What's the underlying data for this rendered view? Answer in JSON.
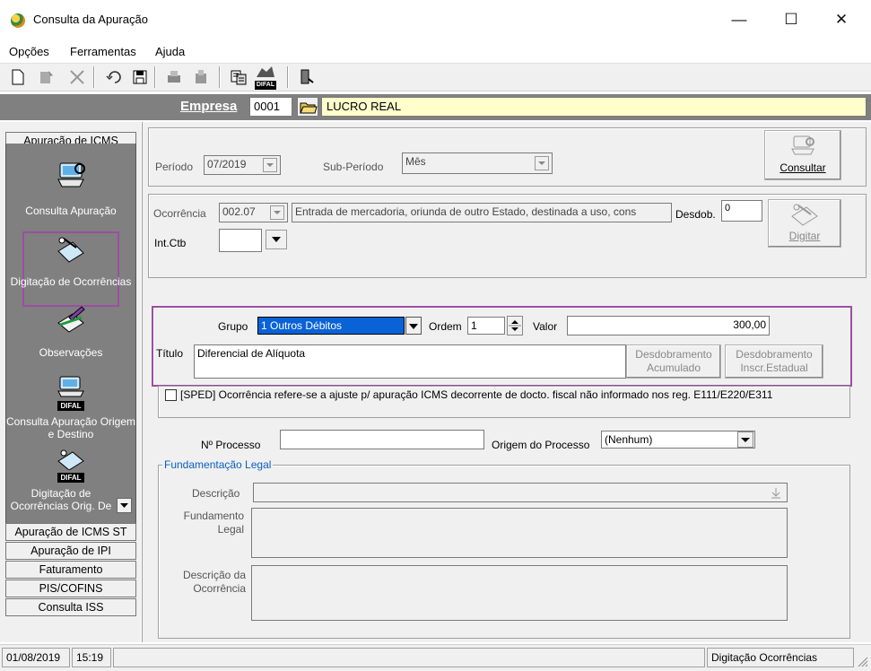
{
  "window": {
    "title": "Consulta da Apuração",
    "minimize": "—",
    "maximize": "☐",
    "close": "✕"
  },
  "menu": [
    "Opções",
    "Ferramentas",
    "Ajuda"
  ],
  "toolbar": {
    "icons": [
      "new-icon",
      "edit-icon",
      "delete-icon",
      "undo-icon",
      "save-icon",
      "print-icon",
      "print-preview-icon",
      "report-icon",
      "difal-icon",
      "exit-door-icon"
    ],
    "difal_text": "DIFAL"
  },
  "empresa": {
    "label": "Empresa",
    "code": "0001",
    "name": "LUCRO REAL"
  },
  "nav": {
    "header": "Apuração de ICMS",
    "items": [
      {
        "label": "Consulta Apuração"
      },
      {
        "label": "Digitação de Ocorrências"
      },
      {
        "label": "Observações"
      },
      {
        "label": "Consulta Apuração Origem e Destino"
      },
      {
        "label": "Digitação de Ocorrências Orig. De"
      }
    ],
    "sections": [
      "Apuração de ICMS ST",
      "Apuração de IPI",
      "Faturamento",
      "PIS/COFINS",
      "Consulta ISS"
    ]
  },
  "form": {
    "periodo_label": "Período",
    "periodo_value": "07/2019",
    "subperiodo_label": "Sub-Período",
    "subperiodo_value": "Mês",
    "consultar_label": "Consultar",
    "ocorrencia_label": "Ocorrência",
    "ocorrencia_code": "002.07",
    "ocorrencia_desc": "Entrada de mercadoria, oriunda de outro Estado, destinada a uso, cons",
    "desdob_label": "Desdob.",
    "desdob_value": "0",
    "digitar_label": "Digitar",
    "intctb_label": "Int.Ctb",
    "intctb_value": "",
    "grupo_label": "Grupo",
    "grupo_value": "1  Outros Débitos",
    "ordem_label": "Ordem",
    "ordem_value": "1",
    "valor_label": "Valor",
    "valor_value": "300,00",
    "titulo_label": "Título",
    "titulo_value": "Diferencial de Alíquota",
    "desdob_acumulado": "Desdobramento Acumulado",
    "desdob_inscr": "Desdobramento Inscr.Estadual",
    "sped_label": "[SPED] Ocorrência refere-se a ajuste p/ apuração ICMS decorrente de docto. fiscal não informado nos reg. E111/E220/E311",
    "processo_label": "Nº Processo",
    "processo_value": "",
    "origem_label": "Origem do Processo",
    "origem_value": "(Nenhum)",
    "fund_legend": "Fundamentação Legal",
    "descricao_label": "Descrição",
    "fundamento_label": "Fundamento Legal",
    "desc_ocorrencia_label": "Descrição da Ocorrência"
  },
  "status": {
    "date": "01/08/2019",
    "time": "15:19",
    "mode": "Digitação Ocorrências"
  },
  "colors": {
    "highlight": "#9b4fa0",
    "empresa_bg": "#ffffcc",
    "nav_bg": "#808080"
  }
}
